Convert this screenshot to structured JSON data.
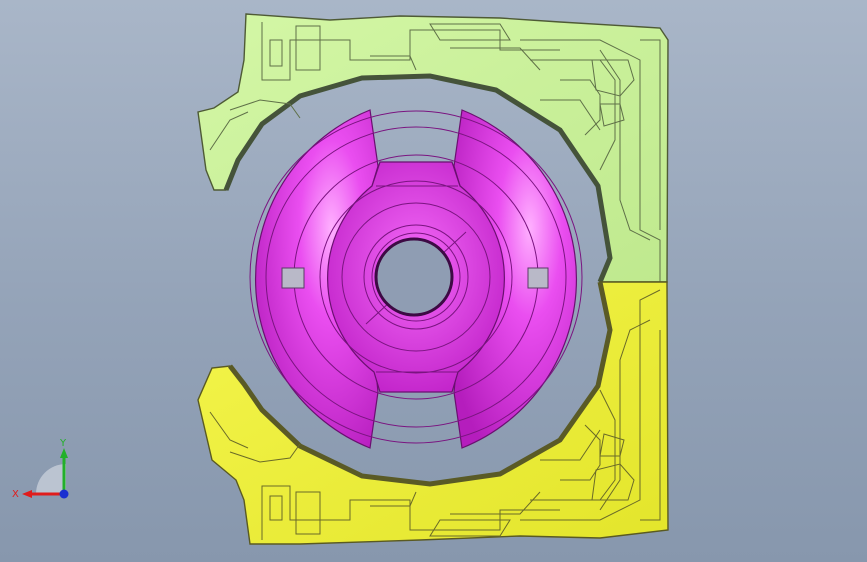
{
  "viewport": {
    "background": "#94a3b8",
    "upper_part_color": "#c9f39a",
    "lower_part_color": "#eef23a",
    "insert_color": "#e23ee8"
  },
  "triad": {
    "x_label": "X",
    "y_label": "Y",
    "x_color": "#e01c1c",
    "y_color": "#22b02a",
    "z_color": "#1a2fd0"
  }
}
